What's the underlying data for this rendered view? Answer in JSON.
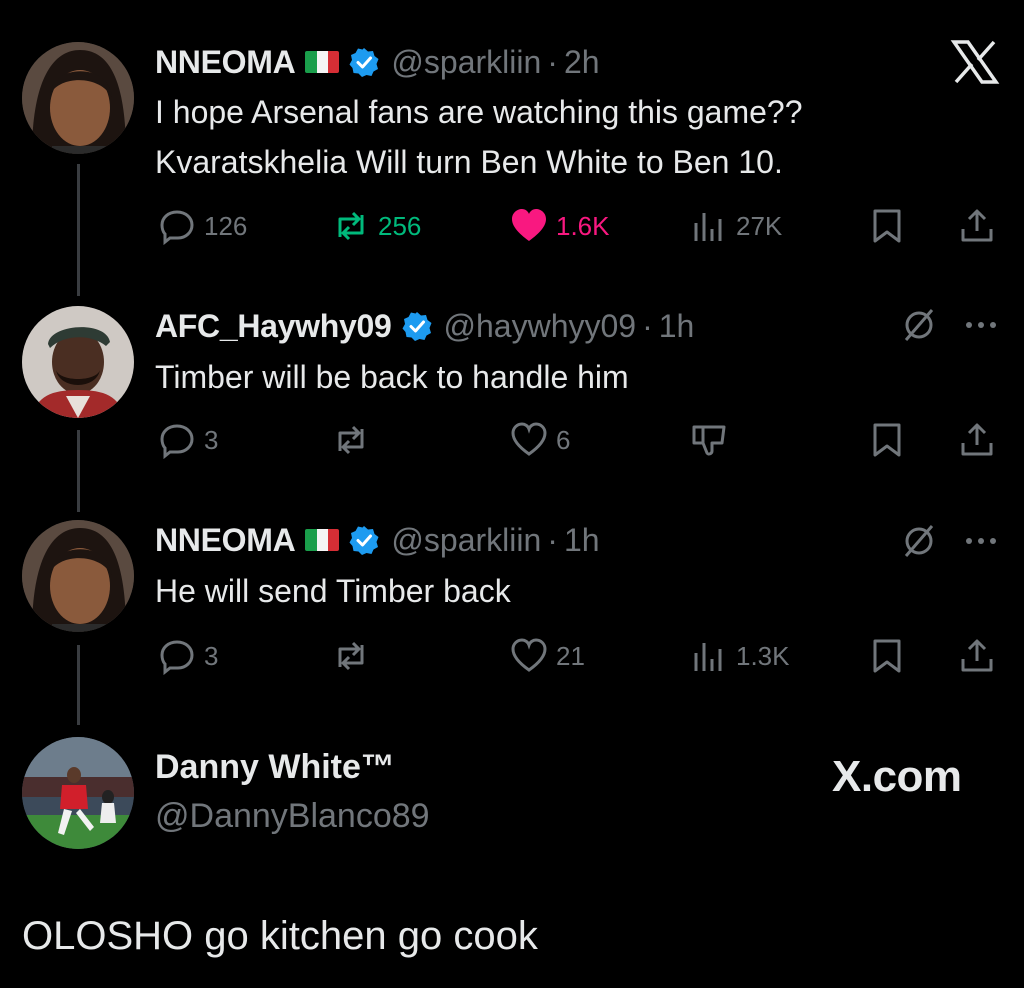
{
  "tweets": [
    {
      "name": "NNEOMA",
      "handle": "@sparkliin",
      "separator": "·",
      "time": "2h",
      "lines": [
        "I hope Arsenal fans are watching this game??",
        "Kvaratskhelia Will turn Ben White to Ben 10."
      ],
      "replies": "126",
      "reposts": "256",
      "likes": "1.6K",
      "views": "27K"
    },
    {
      "name": "AFC_Haywhy09",
      "handle": "@haywhyy09",
      "separator": "·",
      "time": "1h",
      "lines": [
        "Timber will be back to handle him"
      ],
      "replies": "3",
      "reposts": "",
      "likes": "6"
    },
    {
      "name": "NNEOMA",
      "handle": "@sparkliin",
      "separator": "·",
      "time": "1h",
      "lines": [
        "He will send Timber back"
      ],
      "replies": "3",
      "reposts": "",
      "likes": "21",
      "views": "1.3K"
    }
  ],
  "quote_card": {
    "name": "Danny White™",
    "handle": "@DannyBlanco89",
    "brand": "X.com",
    "text": "OLOSHO go kitchen go cook"
  },
  "icons": [
    "x-logo-icon",
    "reply-icon",
    "repost-icon",
    "like-icon",
    "views-icon",
    "bookmark-icon",
    "share-icon",
    "grok-icon",
    "more-icon",
    "dislike-icon",
    "verified-icon",
    "italy-flag-icon"
  ],
  "colors": {
    "background": "#000000",
    "text": "#e7e9ea",
    "secondary": "#71767b",
    "verified": "#1d9bf0",
    "repost": "#00ba7c",
    "like": "#f91880"
  }
}
